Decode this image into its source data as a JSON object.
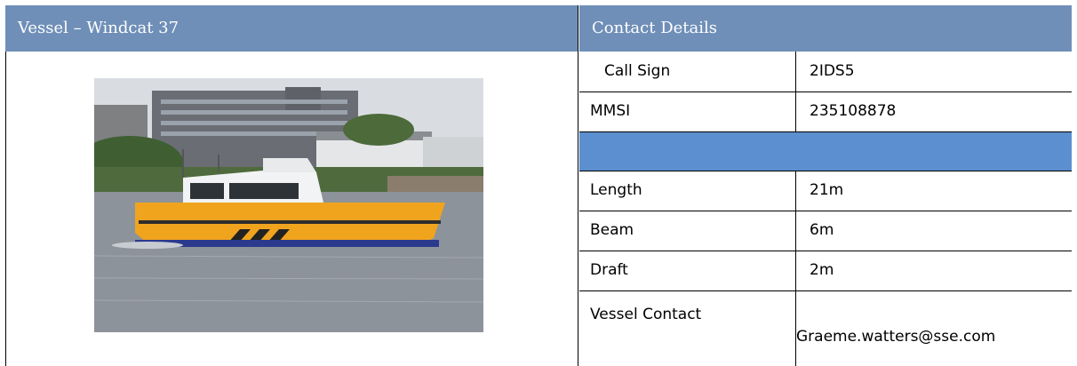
{
  "header": {
    "vessel_title": "Vessel – Windcat 37",
    "contact_title": "Contact Details"
  },
  "colors": {
    "header_bg": "#6f8fb8",
    "band_bg": "#5b8fd0",
    "boat_hull": "#f0a41e"
  },
  "photo": {
    "subject": "yellow crew transfer vessel on water"
  },
  "details": {
    "rows": [
      {
        "label": "Call Sign",
        "value": "2IDS5"
      },
      {
        "label": "MMSI",
        "value": "235108878"
      },
      {
        "label": "Length",
        "value": "21m"
      },
      {
        "label": "Beam",
        "value": "6m"
      },
      {
        "label": "Draft",
        "value": "2m"
      },
      {
        "label": "Vessel Contact",
        "value": "Graeme.watters@sse.com"
      }
    ]
  }
}
